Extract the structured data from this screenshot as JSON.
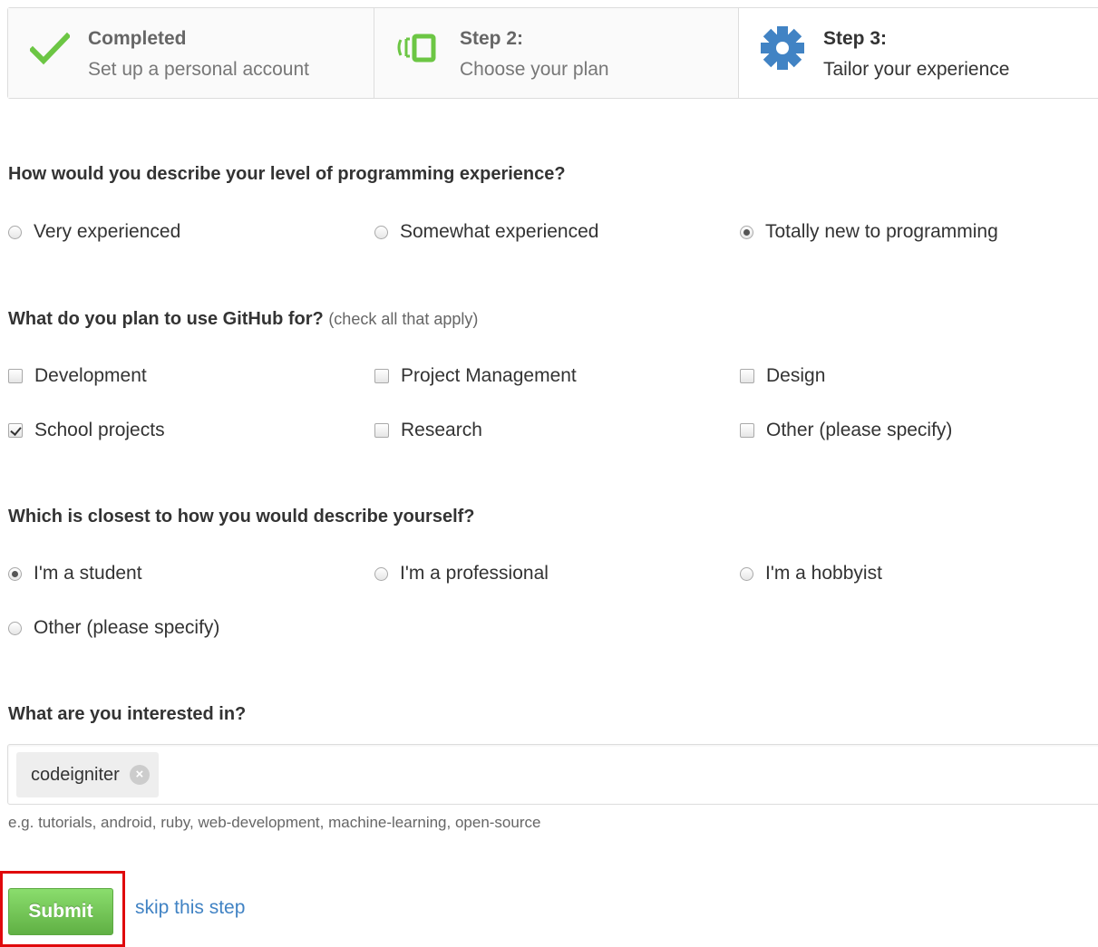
{
  "steps": [
    {
      "title": "Completed",
      "description": "Set up a personal account",
      "icon": "check-icon",
      "color": "#6cc644"
    },
    {
      "title": "Step 2:",
      "description": "Choose your plan",
      "icon": "plan-icon",
      "color": "#6cc644"
    },
    {
      "title": "Step 3:",
      "description": "Tailor your experience",
      "icon": "gear-icon",
      "color": "#4183c4"
    }
  ],
  "questions": {
    "experience": {
      "label": "How would you describe your level of programming experience?",
      "options": [
        "Very experienced",
        "Somewhat experienced",
        "Totally new to programming"
      ],
      "selected": "Totally new to programming"
    },
    "usage": {
      "label": "What do you plan to use GitHub for?",
      "hint": "(check all that apply)",
      "options": [
        "Development",
        "Project Management",
        "Design",
        "School projects",
        "Research",
        "Other (please specify)"
      ],
      "checked": [
        "School projects"
      ]
    },
    "describe": {
      "label": "Which is closest to how you would describe yourself?",
      "options": [
        "I'm a student",
        "I'm a professional",
        "I'm a hobbyist",
        "Other (please specify)"
      ],
      "selected": "I'm a student"
    },
    "interests": {
      "label": "What are you interested in?",
      "tags": [
        "codeigniter"
      ],
      "help": "e.g. tutorials, android, ruby, web-development, machine-learning, open-source"
    }
  },
  "actions": {
    "submit_label": "Submit",
    "skip_label": "skip this step"
  },
  "colors": {
    "accent_green": "#6cc644",
    "link_blue": "#4183c4",
    "highlight_red": "#e0090c"
  }
}
